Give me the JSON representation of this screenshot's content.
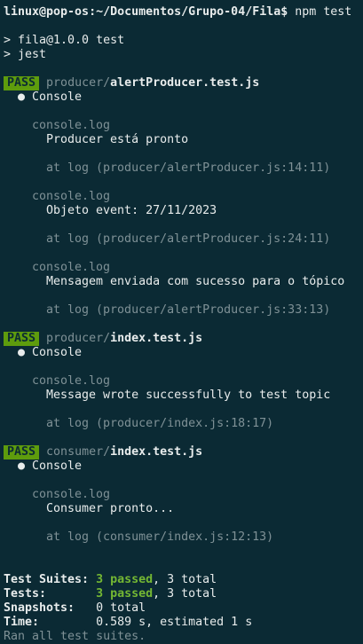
{
  "terminal": {
    "top_fragment": "<",
    "prompt_user": "linux@pop-os",
    "prompt_path": ":~/Documentos/Grupo-04/Fila$",
    "prompt_command": " npm test",
    "npm_lines": [
      "> fila@1.0.0 test",
      "> jest"
    ],
    "pass_badge": "PASS",
    "console_bullet": "● Console",
    "console_log_label": "console.log",
    "suites": [
      {
        "dir": "producer/",
        "file": "alertProducer.test.js",
        "logs": [
          {
            "message": "Producer está pronto",
            "location": "at log (producer/alertProducer.js:14:11)"
          },
          {
            "message": "Objeto event: 27/11/2023",
            "location": "at log (producer/alertProducer.js:24:11)"
          },
          {
            "message": "Mensagem enviada com sucesso para o tópico",
            "location": "at log (producer/alertProducer.js:33:13)"
          }
        ]
      },
      {
        "dir": "producer/",
        "file": "index.test.js",
        "logs": [
          {
            "message": "Message wrote successfully to test topic",
            "location": "at log (producer/index.js:18:17)"
          }
        ]
      },
      {
        "dir": "consumer/",
        "file": "index.test.js",
        "logs": [
          {
            "message": "Consumer pronto...",
            "location": "at log (consumer/index.js:12:13)"
          }
        ]
      }
    ],
    "summary": {
      "suites_label": "Test Suites:",
      "suites_passed": "3 passed",
      "suites_total": ", 3 total",
      "tests_label": "Tests:",
      "tests_passed": "3 passed",
      "tests_total": ", 3 total",
      "snapshots_label": "Snapshots:",
      "snapshots_value": "0 total",
      "time_label": "Time:",
      "time_value": "0.589 s, estimated 1 s",
      "ran_all": "Ran all test suites."
    }
  },
  "colors": {
    "background": "#0b2a34",
    "pass_badge": "#5e9c0d",
    "passed_text": "#74b733",
    "dim_text": "#7f9196",
    "foreground": "#e8ecec"
  }
}
